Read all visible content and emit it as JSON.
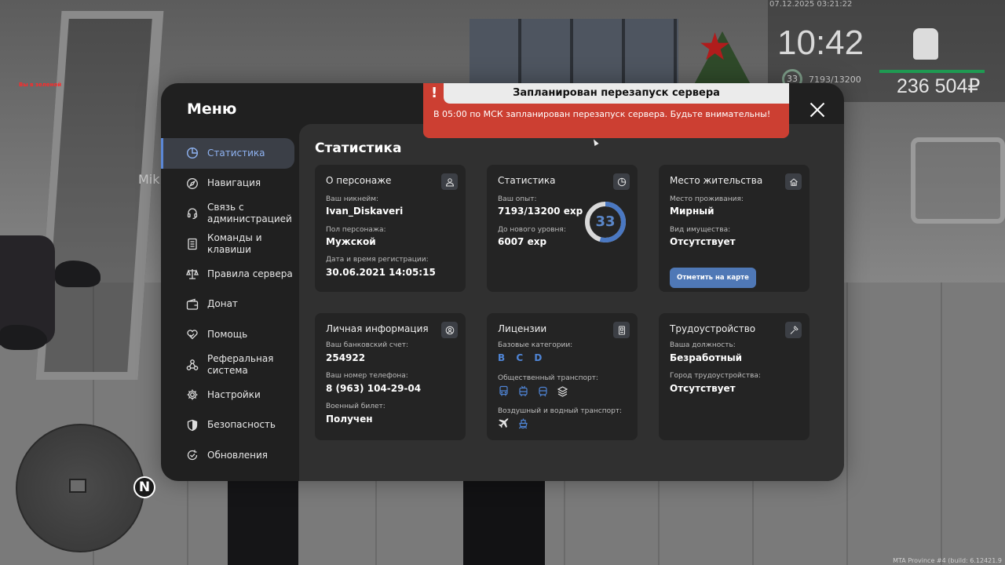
{
  "hud": {
    "datetime": "07.12.2025 03:21:22",
    "clock": "10:42",
    "level": "33",
    "exp": "7193/13200",
    "money": "236 504₽"
  },
  "world": {
    "player_tag": "Вы в зеленой",
    "npc_name": "Mik",
    "minimap_north": "N",
    "build_info": "MTA Province #4 (build: 6.12421.9"
  },
  "notification": {
    "mark": "!",
    "title": "Запланирован перезапуск сервера",
    "message": "В 05:00 по МСК запланирован перезапуск сервера. Будьте внимательны!"
  },
  "menu": {
    "title": "Меню",
    "items": [
      {
        "label": "Статистика",
        "icon": "chart-pie-icon"
      },
      {
        "label": "Навигация",
        "icon": "compass-icon"
      },
      {
        "label": "Связь с администрацией",
        "icon": "headset-icon"
      },
      {
        "label": "Команды и клавиши",
        "icon": "document-icon"
      },
      {
        "label": "Правила сервера",
        "icon": "scales-icon"
      },
      {
        "label": "Донат",
        "icon": "wallet-icon"
      },
      {
        "label": "Помощь",
        "icon": "heart-hand-icon"
      },
      {
        "label": "Реферальная система",
        "icon": "network-icon"
      },
      {
        "label": "Настройки",
        "icon": "gear-icon"
      },
      {
        "label": "Безопасность",
        "icon": "shield-icon"
      },
      {
        "label": "Обновления",
        "icon": "refresh-check-icon"
      }
    ]
  },
  "stats": {
    "title": "Статистика",
    "character": {
      "title": "О персонаже",
      "nick_label": "Ваш никнейм:",
      "nick": "Ivan_Diskaveri",
      "gender_label": "Пол персонажа:",
      "gender": "Мужской",
      "reg_label": "Дата и время регистрации:",
      "reg": "30.06.2021 14:05:15"
    },
    "statistics": {
      "title": "Статистика",
      "exp_label": "Ваш опыт:",
      "exp": "7193/13200 exp",
      "next_label": "До нового уровня:",
      "next": "6007 exp",
      "level": "33",
      "progress": 0.545
    },
    "residence": {
      "title": "Место жительства",
      "place_label": "Место проживания:",
      "place": "Мирный",
      "property_label": "Вид имущества:",
      "property": "Отсутствует",
      "map_button": "Отметить на карте"
    },
    "personal": {
      "title": "Личная информация",
      "bank_label": "Ваш банковский счет:",
      "bank": "254922",
      "phone_label": "Ваш номер телефона:",
      "phone": "8 (963) 104-29-04",
      "military_label": "Военный билет:",
      "military": "Получен"
    },
    "licenses": {
      "title": "Лицензии",
      "base_label": "Базовые категории:",
      "categories": [
        "B",
        "C",
        "D"
      ],
      "public_label": "Общественный транспорт:",
      "air_label": "Воздушный и водный транспорт:"
    },
    "employment": {
      "title": "Трудоустройство",
      "position_label": "Ваша должность:",
      "position": "Безработный",
      "city_label": "Город трудоустройства:",
      "city": "Отсутствует"
    }
  },
  "colors": {
    "accent": "#5b87d6",
    "notice": "#cc3f32",
    "modal": "#202020",
    "card": "#242424"
  }
}
